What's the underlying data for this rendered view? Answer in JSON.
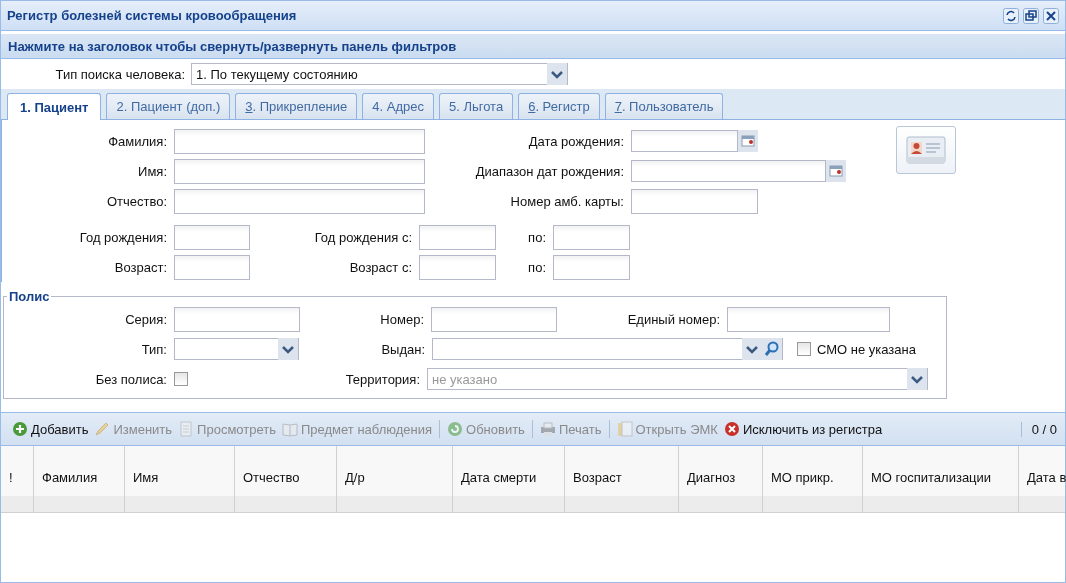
{
  "window": {
    "title": "Регистр болезней системы кровообращения"
  },
  "filter_panel": {
    "header": "Нажмите на заголовок чтобы свернуть/развернуть панель фильтров",
    "search_type": {
      "label": "Тип поиска человека:",
      "value": "1. По текущему состоянию"
    },
    "tabs": [
      {
        "label": "1. Пациент",
        "selected": true,
        "mnemonic": false
      },
      {
        "label": "2. Пациент (доп.)",
        "selected": false,
        "mnemonic": false
      },
      {
        "label": "3. Прикрепление",
        "selected": false,
        "mnemonic": true
      },
      {
        "label": "4. Адрес",
        "selected": false,
        "mnemonic": false
      },
      {
        "label": "5. Льгота",
        "selected": false,
        "mnemonic": false
      },
      {
        "label": "6. Регистр",
        "selected": false,
        "mnemonic": true
      },
      {
        "label": "7. Пользователь",
        "selected": false,
        "mnemonic": true
      }
    ],
    "patient_rows": [
      [
        {
          "label": "Фамилия:",
          "kind": "text"
        },
        {
          "label": "Дата рождения:",
          "kind": "date"
        }
      ],
      [
        {
          "label": "Имя:",
          "kind": "text"
        },
        {
          "label": "Диапазон дат рождения:",
          "kind": "date"
        }
      ],
      [
        {
          "label": "Отчество:",
          "kind": "text"
        },
        {
          "label": "Номер амб. карты:",
          "kind": "text"
        }
      ],
      [
        {
          "label": "Год рождения:",
          "kind": "text"
        },
        {
          "label": "Год рождения с:",
          "kind": "text"
        },
        {
          "label": "по:",
          "kind": "text"
        }
      ],
      [
        {
          "label": "Возраст:",
          "kind": "text"
        },
        {
          "label": "Возраст с:",
          "kind": "text"
        },
        {
          "label": "по:",
          "kind": "text"
        }
      ]
    ],
    "policy": {
      "legend": "Полис",
      "rows": [
        [
          {
            "label": "Серия:",
            "kind": "text"
          },
          {
            "label": "Номер:",
            "kind": "text"
          },
          {
            "label": "Единый номер:",
            "kind": "text"
          }
        ],
        [
          {
            "label": "Тип:",
            "kind": "combo"
          },
          {
            "label": "Выдан:",
            "kind": "lookup"
          },
          {
            "label": "СМО не указана",
            "kind": "checkbox",
            "checked": false
          }
        ],
        [
          {
            "label": "Без полиса:",
            "kind": "checkbox",
            "checked": false
          },
          {
            "label": "Территория:",
            "kind": "combo",
            "placeholder": "не указано"
          }
        ]
      ]
    }
  },
  "toolbar": {
    "groups": [
      [
        {
          "label": "Добавить",
          "kind": "add",
          "disabled": false
        },
        {
          "label": "Изменить",
          "kind": "edit",
          "disabled": true
        },
        {
          "label": "Просмотреть",
          "kind": "view",
          "disabled": true
        },
        {
          "label": "Предмет наблюдения",
          "kind": "book",
          "disabled": true
        }
      ],
      [
        {
          "label": "Обновить",
          "kind": "refresh",
          "disabled": true
        }
      ],
      [
        {
          "label": "Печать",
          "kind": "print",
          "disabled": true
        }
      ],
      [
        {
          "label": "Открыть ЭМК",
          "kind": "folder",
          "disabled": true
        },
        {
          "label": "Исключить из регистра",
          "kind": "delete",
          "disabled": false
        }
      ]
    ],
    "paging": "0 / 0"
  },
  "table": {
    "columns": [
      "!",
      "Фамилия",
      "Имя",
      "Отчество",
      "Д/р",
      "Дата смерти",
      "Возраст",
      "Диагноз",
      "МО прикр.",
      "МО госпитализации",
      "Дата в"
    ]
  }
}
